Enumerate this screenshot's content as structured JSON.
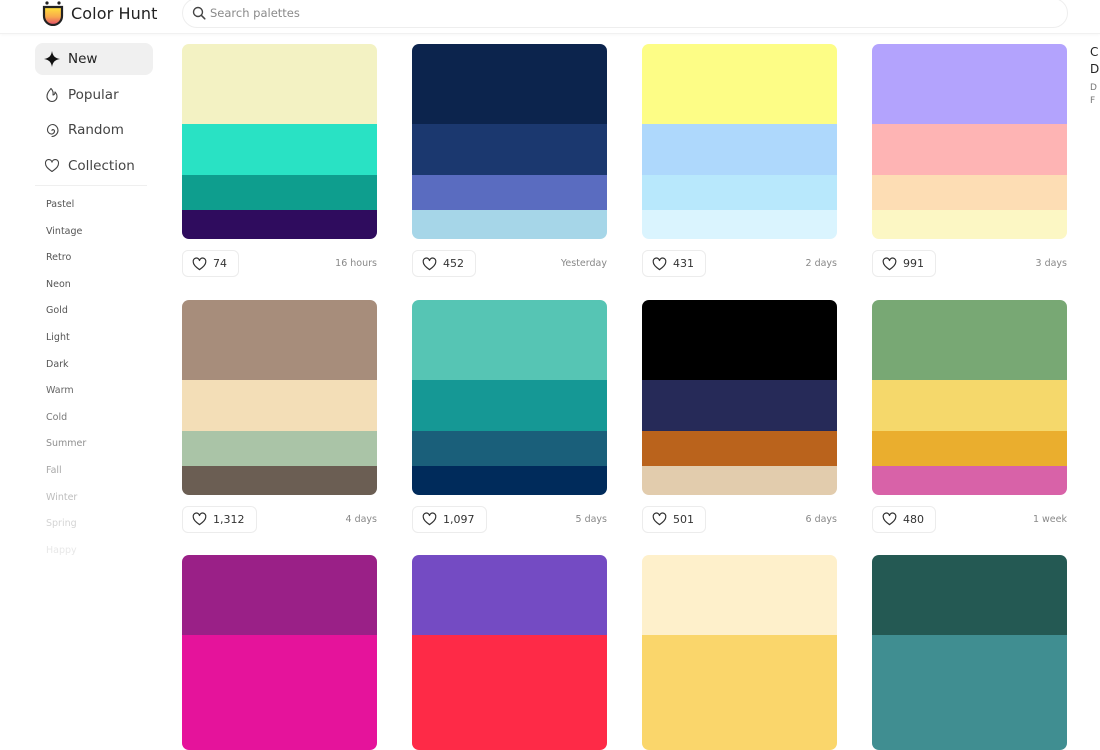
{
  "app": {
    "name": "Color Hunt"
  },
  "search": {
    "placeholder": "Search palettes",
    "value": ""
  },
  "nav": [
    {
      "label": "New",
      "icon": "sparkle-icon",
      "active": true
    },
    {
      "label": "Popular",
      "icon": "flame-icon",
      "active": false
    },
    {
      "label": "Random",
      "icon": "spiral-icon",
      "active": false
    },
    {
      "label": "Collection",
      "icon": "heart-icon",
      "active": false
    }
  ],
  "tags": [
    {
      "label": "Pastel",
      "color": "#555555"
    },
    {
      "label": "Vintage",
      "color": "#555555"
    },
    {
      "label": "Retro",
      "color": "#555555"
    },
    {
      "label": "Neon",
      "color": "#555555"
    },
    {
      "label": "Gold",
      "color": "#555555"
    },
    {
      "label": "Light",
      "color": "#555555"
    },
    {
      "label": "Dark",
      "color": "#555555"
    },
    {
      "label": "Warm",
      "color": "#666666"
    },
    {
      "label": "Cold",
      "color": "#777777"
    },
    {
      "label": "Summer",
      "color": "#8f8f8f"
    },
    {
      "label": "Fall",
      "color": "#a8a8a8"
    },
    {
      "label": "Winter",
      "color": "#bdbdbd"
    },
    {
      "label": "Spring",
      "color": "#d4d4d4"
    },
    {
      "label": "Happy",
      "color": "#e8e8e8"
    }
  ],
  "palettes": [
    {
      "colors": [
        "#F3F2C3",
        "#29E2C4",
        "#0E9E8E",
        "#2F0C5E"
      ],
      "likes": "74",
      "age": "16 hours"
    },
    {
      "colors": [
        "#0C244D",
        "#1B386F",
        "#5A6CC0",
        "#A6D6E8"
      ],
      "likes": "452",
      "age": "Yesterday"
    },
    {
      "colors": [
        "#FDFD86",
        "#AED8FC",
        "#B8E8FC",
        "#DAF4FE"
      ],
      "likes": "431",
      "age": "2 days"
    },
    {
      "colors": [
        "#B3A3FD",
        "#FEB4B4",
        "#FDDDB4",
        "#FCF7C4"
      ],
      "likes": "991",
      "age": "3 days"
    },
    {
      "colors": [
        "#A78D7B",
        "#F3DEB7",
        "#AAC4A7",
        "#6B5E53"
      ],
      "likes": "1,312",
      "age": "4 days"
    },
    {
      "colors": [
        "#56C5B4",
        "#159895",
        "#1A5F7A",
        "#002B5B"
      ],
      "likes": "1,097",
      "age": "5 days"
    },
    {
      "colors": [
        "#000000",
        "#262A58",
        "#BA631C",
        "#E2CCAD"
      ],
      "likes": "501",
      "age": "6 days"
    },
    {
      "colors": [
        "#78A874",
        "#F5D86B",
        "#EAAE2E",
        "#D862A8"
      ],
      "likes": "480",
      "age": "1 week"
    },
    {
      "colors": [
        "#9A2087",
        "#E5139B",
        "#E5139B",
        "#E5139B"
      ],
      "likes": "",
      "age": ""
    },
    {
      "colors": [
        "#744BC3",
        "#FE2A47",
        "#FE2A47",
        "#FE2A47"
      ],
      "likes": "",
      "age": ""
    },
    {
      "colors": [
        "#FEF0CB",
        "#FAD66B",
        "#FAD66B",
        "#FAD66B"
      ],
      "likes": "",
      "age": ""
    },
    {
      "colors": [
        "#245953",
        "#408E91",
        "#408E91",
        "#408E91"
      ],
      "likes": "",
      "age": ""
    }
  ],
  "side_panel": {
    "line1": "C",
    "line2": "D",
    "line3": "D",
    "line4": "F"
  }
}
